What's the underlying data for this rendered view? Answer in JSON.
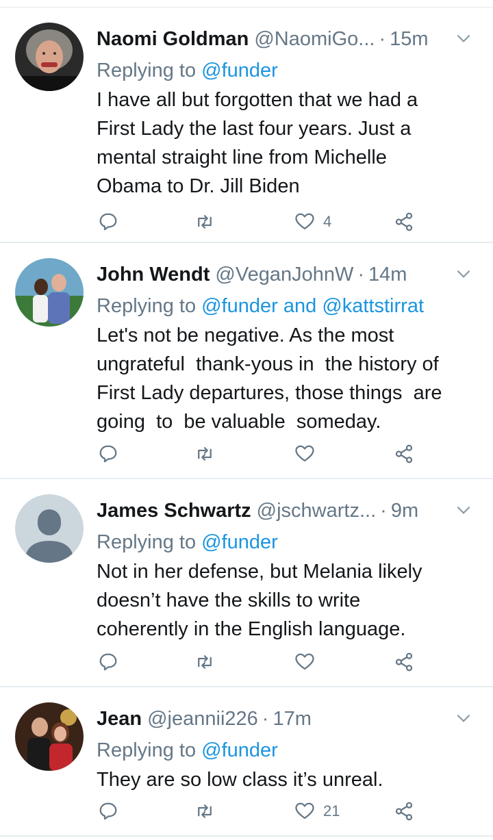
{
  "tweets": [
    {
      "name": "Naomi Goldman",
      "handle": "@NaomiGo...",
      "time": "15m",
      "reply_prefix": "Replying to ",
      "reply_mentions": "@funder",
      "text": "I have all but forgotten that we had a\nFirst Lady the last four years. Just a\nmental straight line from Michelle\nObama to Dr. Jill Biden",
      "like_count": "4",
      "avatar": "woman-photo"
    },
    {
      "name": "John Wendt",
      "handle": "@VeganJohnW",
      "time": "14m",
      "reply_prefix": "Replying to ",
      "reply_mentions": "@funder and @kattstirrat",
      "text": "Let's not be negative. As the most\nungrateful  thank-yous in  the history of\nFirst Lady departures, those things  are\ngoing  to  be valuable  someday.",
      "like_count": "",
      "avatar": "couple-photo"
    },
    {
      "name": "James Schwartz",
      "handle": "@jschwartz...",
      "time": "9m",
      "reply_prefix": "Replying to ",
      "reply_mentions": "@funder",
      "text": "Not in her defense, but Melania likely\ndoesn’t have the skills to write\ncoherently in the English language.",
      "like_count": "",
      "avatar": "default-avatar"
    },
    {
      "name": "Jean",
      "handle": "@jeannii226",
      "time": "17m",
      "reply_prefix": "Replying to ",
      "reply_mentions": "@funder",
      "text": "They are so low class it’s unreal.",
      "like_count": "21",
      "avatar": "couple-holiday-photo"
    }
  ],
  "separator": "·",
  "colors": {
    "text": "#14171a",
    "secondary": "#657786",
    "link": "#1b95e0",
    "divider": "#e6ecf0"
  },
  "icons": [
    "reply-icon",
    "retweet-icon",
    "like-icon",
    "share-icon",
    "chevron-down-icon"
  ]
}
